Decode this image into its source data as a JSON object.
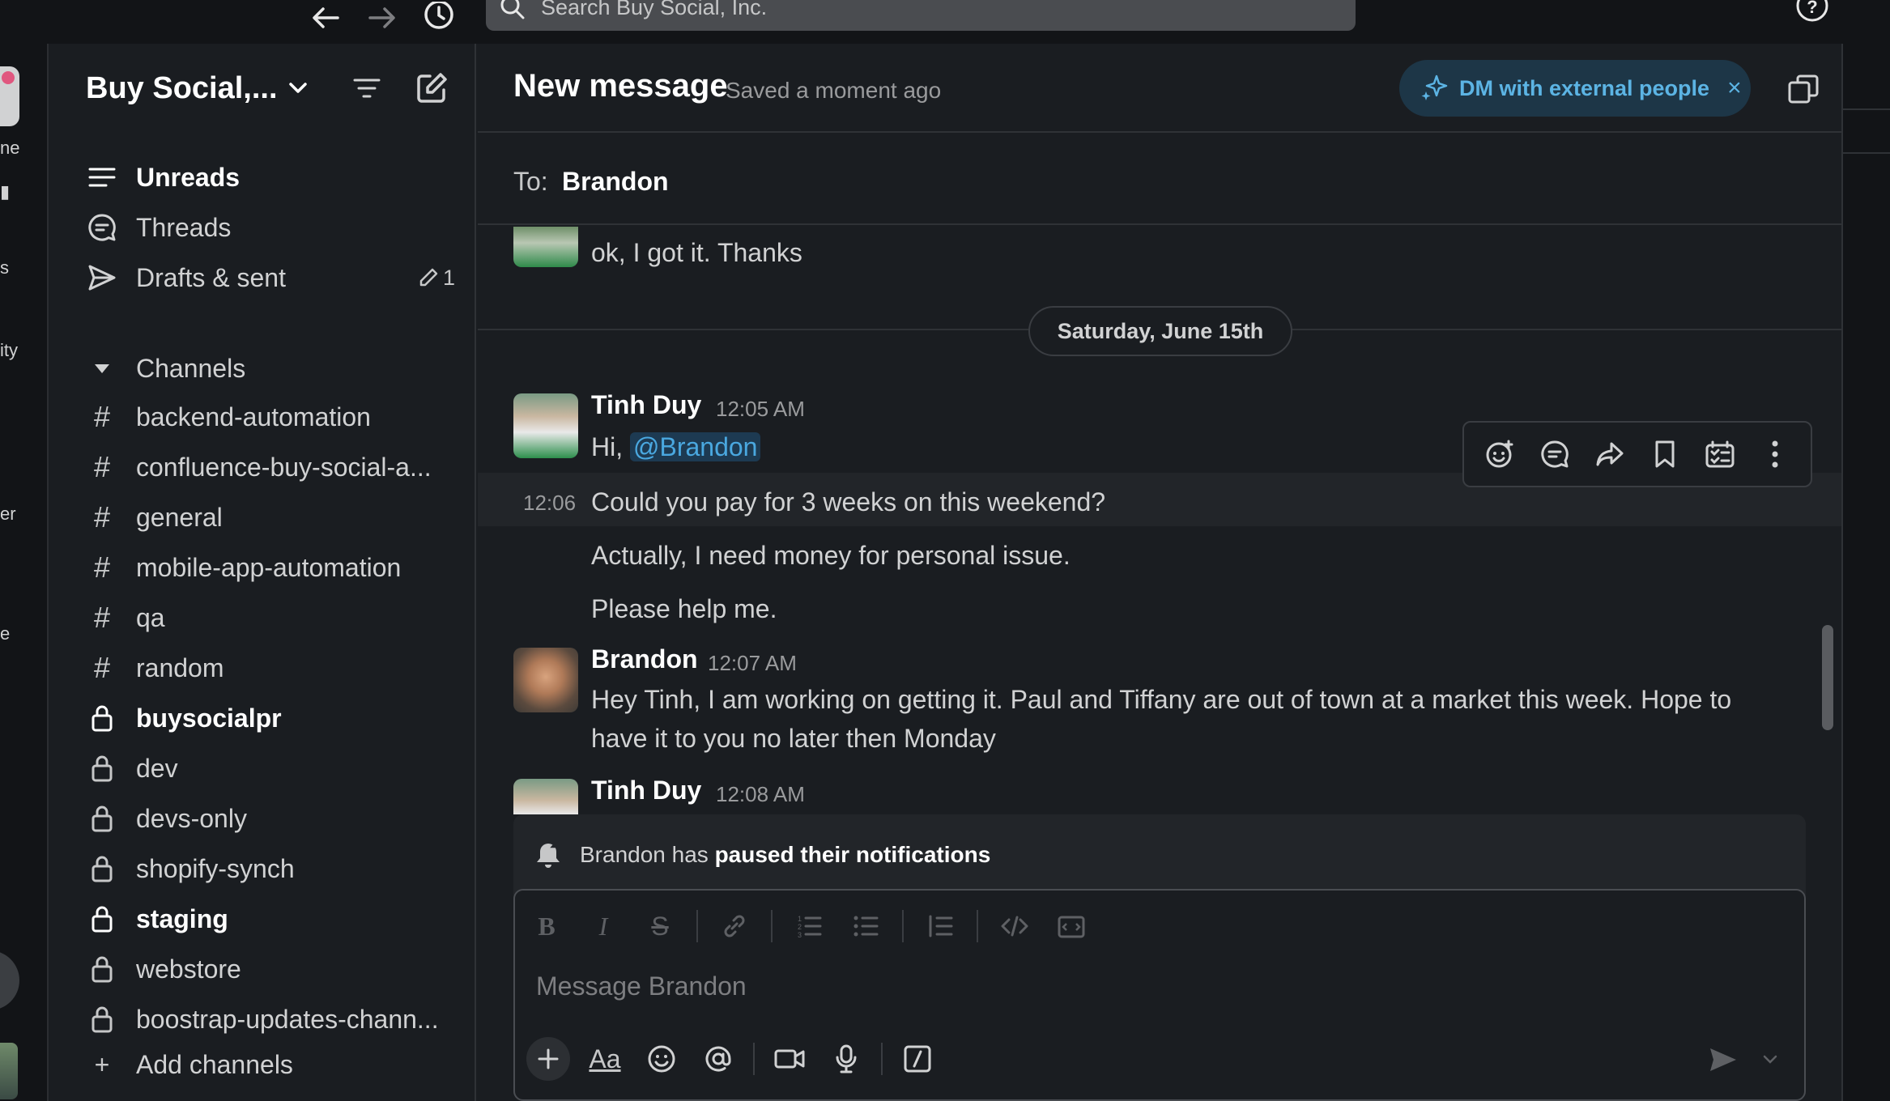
{
  "search": {
    "placeholder": "Search Buy Social, Inc."
  },
  "rail": {
    "fragments": [
      "ne",
      "s",
      "ity",
      "er",
      "e"
    ]
  },
  "workspace": {
    "name": "Buy Social,..."
  },
  "nav": {
    "unreads": "Unreads",
    "threads": "Threads",
    "drafts": "Drafts & sent",
    "drafts_count": "1"
  },
  "channels_section": {
    "title": "Channels",
    "add_label": "Add channels"
  },
  "channels": [
    {
      "name": "backend-automation",
      "type": "public",
      "unread": false
    },
    {
      "name": "confluence-buy-social-a...",
      "type": "public",
      "unread": false
    },
    {
      "name": "general",
      "type": "public",
      "unread": false
    },
    {
      "name": "mobile-app-automation",
      "type": "public",
      "unread": false
    },
    {
      "name": "qa",
      "type": "public",
      "unread": false
    },
    {
      "name": "random",
      "type": "public",
      "unread": false
    },
    {
      "name": "buysocialpr",
      "type": "private",
      "unread": true
    },
    {
      "name": "dev",
      "type": "private",
      "unread": false
    },
    {
      "name": "devs-only",
      "type": "private",
      "unread": false
    },
    {
      "name": "shopify-synch",
      "type": "private",
      "unread": false
    },
    {
      "name": "staging",
      "type": "private",
      "unread": true
    },
    {
      "name": "webstore",
      "type": "private",
      "unread": false
    },
    {
      "name": "boostrap-updates-chann...",
      "type": "private",
      "unread": false
    }
  ],
  "header": {
    "title": "New message",
    "saved": "Saved a moment ago",
    "dm_pill": "DM with external people",
    "dm_close": "×"
  },
  "to": {
    "label": "To:",
    "name": "Brandon"
  },
  "messages": {
    "top_partial": "ok, I got it. Thanks",
    "date_divider": "Saturday, June 15th",
    "m1": {
      "author": "Tinh Duy",
      "time": "12:05 AM",
      "prefix": "Hi, ",
      "mention": "@Brandon"
    },
    "m1_cont": [
      {
        "time": "12:06",
        "text": "Could you pay for 3 weeks on this weekend?"
      },
      {
        "text": "Actually, I need money for personal issue."
      },
      {
        "text": "Please help me."
      }
    ],
    "m2": {
      "author": "Brandon",
      "time": "12:07 AM",
      "line1": "Hey Tinh, I am working on getting it. Paul and Tiffany are out of town at a market this week. Hope to",
      "line2": "have it to you no later then Monday"
    },
    "m3": {
      "author": "Tinh Duy",
      "time": "12:08 AM"
    }
  },
  "notice": {
    "prefix": "Brandon has ",
    "bold": "paused their notifications"
  },
  "composer": {
    "placeholder": "Message Brandon",
    "aa_label": "Aa"
  },
  "colors": {
    "background": "#1a1d21",
    "rail": "#121417",
    "accent_link": "#4aa8e0",
    "dm_pill_bg": "#1d3647",
    "dm_pill_fg": "#5cb4e4"
  }
}
